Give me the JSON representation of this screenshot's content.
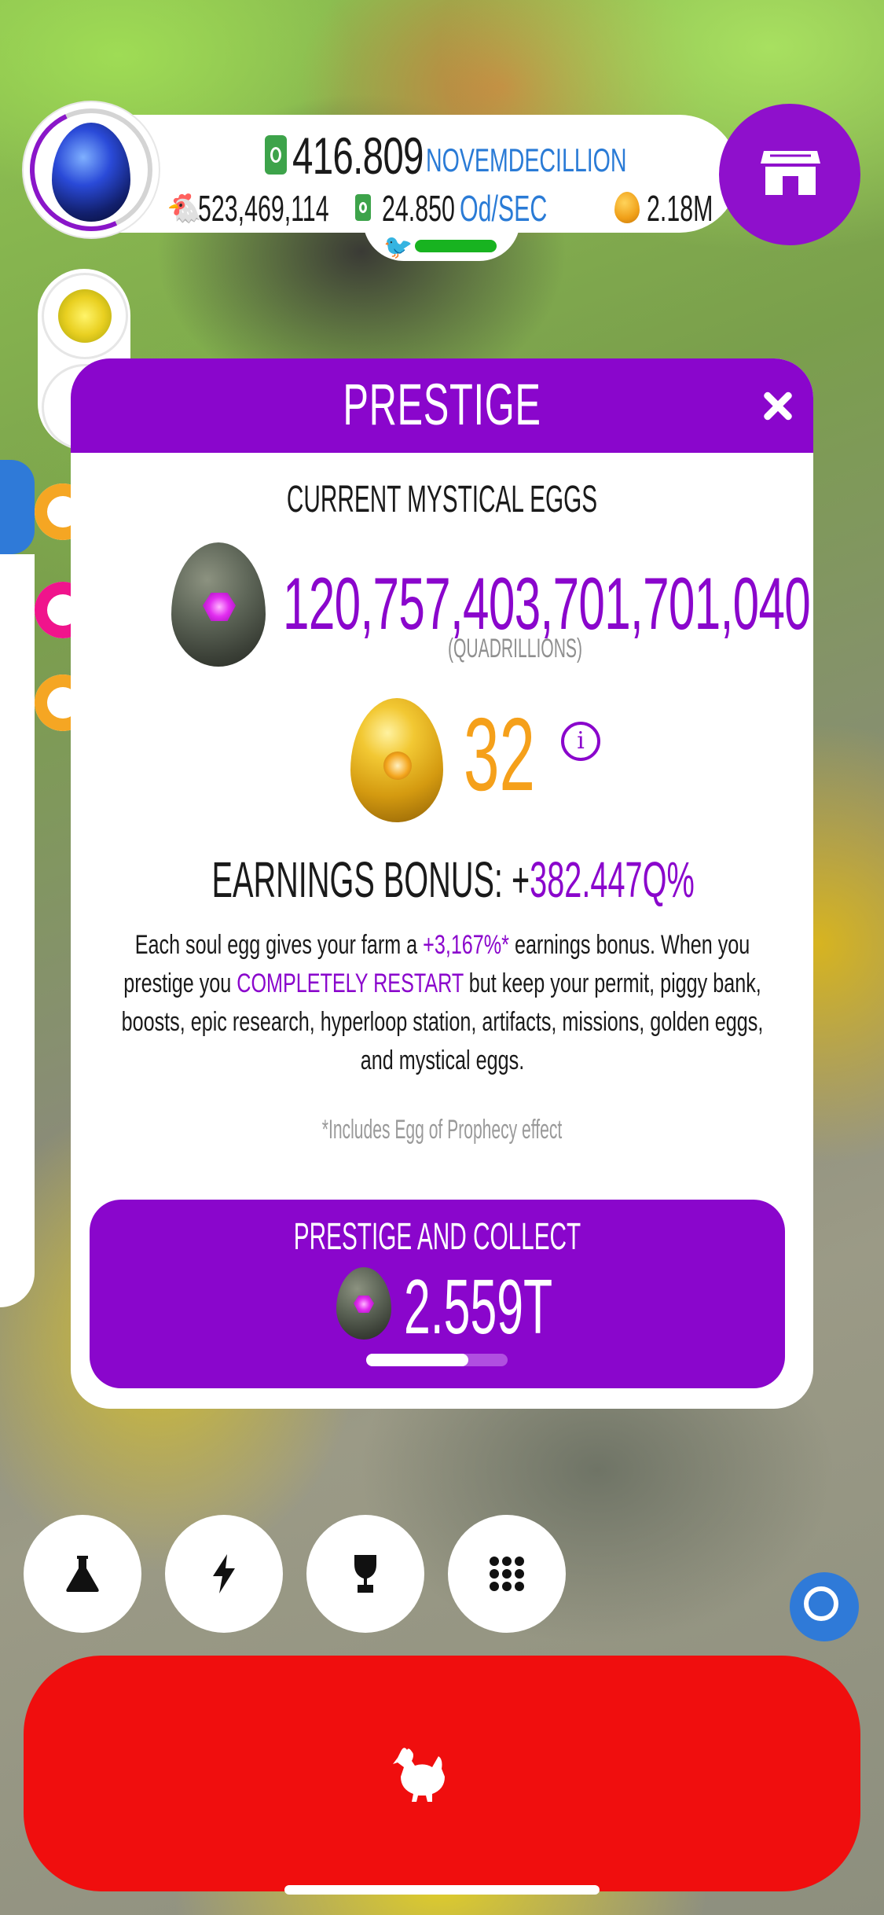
{
  "hud": {
    "money_value": "416.809",
    "money_unit": "NOVEMDECILLION",
    "chickens": "523,469,114",
    "earning_rate_value": "24.850",
    "earning_rate_unit": "Od/SEC",
    "golden_eggs": "2.18M"
  },
  "modal": {
    "title": "PRESTIGE",
    "section_label": "CURRENT MYSTICAL EGGS",
    "mystical_eggs_value": "120,757,403,701,701,040",
    "mystical_eggs_unit": "(QUADRILLIONS)",
    "prophecy_eggs": "32",
    "info_glyph": "i",
    "bonus_label": "EARNINGS BONUS: +",
    "bonus_value": "382.447Q%",
    "description": {
      "part1": "Each soul egg gives your farm a ",
      "soul_egg_bonus": "+3,167%*",
      "part2": " earnings bonus. When you prestige you ",
      "restart": "COMPLETELY RESTART",
      "part3": " but keep your permit, piggy bank, boosts, epic research, hyperloop station, artifacts, missions, golden eggs, and mystical eggs."
    },
    "footnote": "*Includes Egg of Prophecy effect",
    "collect_button": {
      "label": "PRESTIGE AND COLLECT",
      "value": "2.559T",
      "progress_fraction": 0.72
    }
  },
  "colors": {
    "purple": "#8a06cc",
    "orange": "#f5a01a",
    "blue": "#2a7bd6",
    "red": "#f00e0e"
  },
  "bottom_buttons": [
    "flask-icon",
    "lightning-icon",
    "trophy-icon",
    "grid-icon"
  ]
}
